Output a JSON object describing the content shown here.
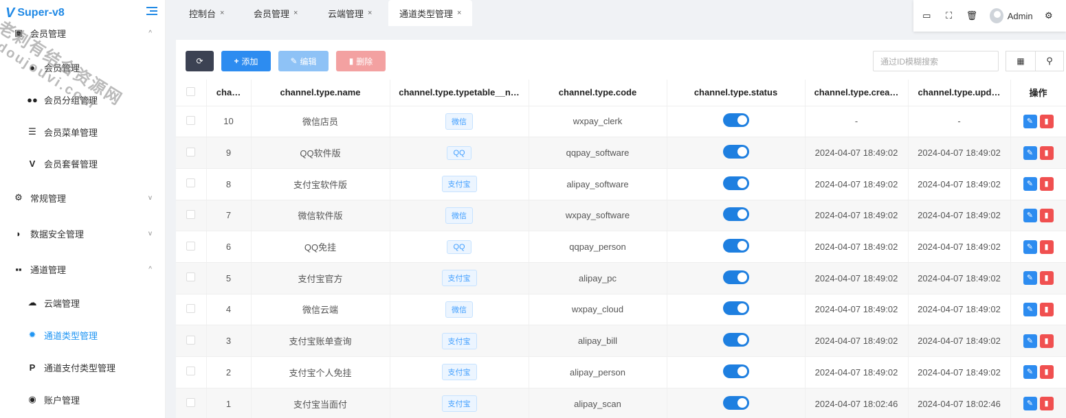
{
  "brand": {
    "logo": "V",
    "name": "Super-v8"
  },
  "sidebar": {
    "items": [
      {
        "label": "会员管理",
        "icon": "id-card-icon",
        "glyph": "▣",
        "level": "top",
        "chev": "^"
      },
      {
        "label": "会员管理",
        "icon": "user-icon",
        "glyph": "●",
        "level": "sub"
      },
      {
        "label": "会员分组管理",
        "icon": "users-icon",
        "glyph": "●●",
        "level": "sub"
      },
      {
        "label": "会员菜单管理",
        "icon": "list-icon",
        "glyph": "☰",
        "level": "sub"
      },
      {
        "label": "会员套餐管理",
        "icon": "vimeo-icon",
        "glyph": "V",
        "level": "sub"
      },
      {
        "label": "常规管理",
        "icon": "cogs-icon",
        "glyph": "⚙",
        "level": "top",
        "chev": "v"
      },
      {
        "label": "数据安全管理",
        "icon": "shield-icon",
        "glyph": "◗",
        "level": "top",
        "chev": "v"
      },
      {
        "label": "通道管理",
        "icon": "grid-icon",
        "glyph": "▪▪",
        "level": "top",
        "chev": "^"
      },
      {
        "label": "云端管理",
        "icon": "cloud-icon",
        "glyph": "☁",
        "level": "sub"
      },
      {
        "label": "通道类型管理",
        "icon": "badge-icon",
        "glyph": "✹",
        "level": "sub",
        "active": true
      },
      {
        "label": "通道支付类型管理",
        "icon": "paypal-icon",
        "glyph": "P",
        "level": "sub"
      },
      {
        "label": "账户管理",
        "icon": "rocket-icon",
        "glyph": "◉",
        "level": "sub"
      }
    ]
  },
  "tabs": [
    {
      "label": "控制台",
      "close": "×"
    },
    {
      "label": "会员管理",
      "close": "×"
    },
    {
      "label": "云端管理",
      "close": "×"
    },
    {
      "label": "通道类型管理",
      "close": "×",
      "active": true
    }
  ],
  "header": {
    "user": "Admin"
  },
  "toolbar": {
    "add": "添加",
    "edit": "编辑",
    "delete": "删除",
    "search_placeholder": "通过ID模糊搜索"
  },
  "table": {
    "columns": [
      "cha…",
      "channel.type.name",
      "channel.type.typetable__n…",
      "channel.type.code",
      "channel.type.status",
      "channel.type.crea…",
      "channel.type.upd…",
      "操作"
    ],
    "rows": [
      {
        "id": "10",
        "name": "微信店员",
        "tag": "微信",
        "code": "wxpay_clerk",
        "created": "-",
        "updated": "-"
      },
      {
        "id": "9",
        "name": "QQ软件版",
        "tag": "QQ",
        "code": "qqpay_software",
        "created": "2024-04-07 18:49:02",
        "updated": "2024-04-07 18:49:02"
      },
      {
        "id": "8",
        "name": "支付宝软件版",
        "tag": "支付宝",
        "code": "alipay_software",
        "created": "2024-04-07 18:49:02",
        "updated": "2024-04-07 18:49:02"
      },
      {
        "id": "7",
        "name": "微信软件版",
        "tag": "微信",
        "code": "wxpay_software",
        "created": "2024-04-07 18:49:02",
        "updated": "2024-04-07 18:49:02"
      },
      {
        "id": "6",
        "name": "QQ免挂",
        "tag": "QQ",
        "code": "qqpay_person",
        "created": "2024-04-07 18:49:02",
        "updated": "2024-04-07 18:49:02"
      },
      {
        "id": "5",
        "name": "支付宝官方",
        "tag": "支付宝",
        "code": "alipay_pc",
        "created": "2024-04-07 18:49:02",
        "updated": "2024-04-07 18:49:02"
      },
      {
        "id": "4",
        "name": "微信云端",
        "tag": "微信",
        "code": "wxpay_cloud",
        "created": "2024-04-07 18:49:02",
        "updated": "2024-04-07 18:49:02"
      },
      {
        "id": "3",
        "name": "支付宝账单查询",
        "tag": "支付宝",
        "code": "alipay_bill",
        "created": "2024-04-07 18:49:02",
        "updated": "2024-04-07 18:49:02"
      },
      {
        "id": "2",
        "name": "支付宝个人免挂",
        "tag": "支付宝",
        "code": "alipay_person",
        "created": "2024-04-07 18:49:02",
        "updated": "2024-04-07 18:49:02"
      },
      {
        "id": "1",
        "name": "支付宝当面付",
        "tag": "支付宝",
        "code": "alipay_scan",
        "created": "2024-04-07 18:02:46",
        "updated": "2024-04-07 18:02:46"
      }
    ]
  },
  "watermark": {
    "line1": "老刺有结合资源网",
    "line2": "doujouvi.com"
  }
}
